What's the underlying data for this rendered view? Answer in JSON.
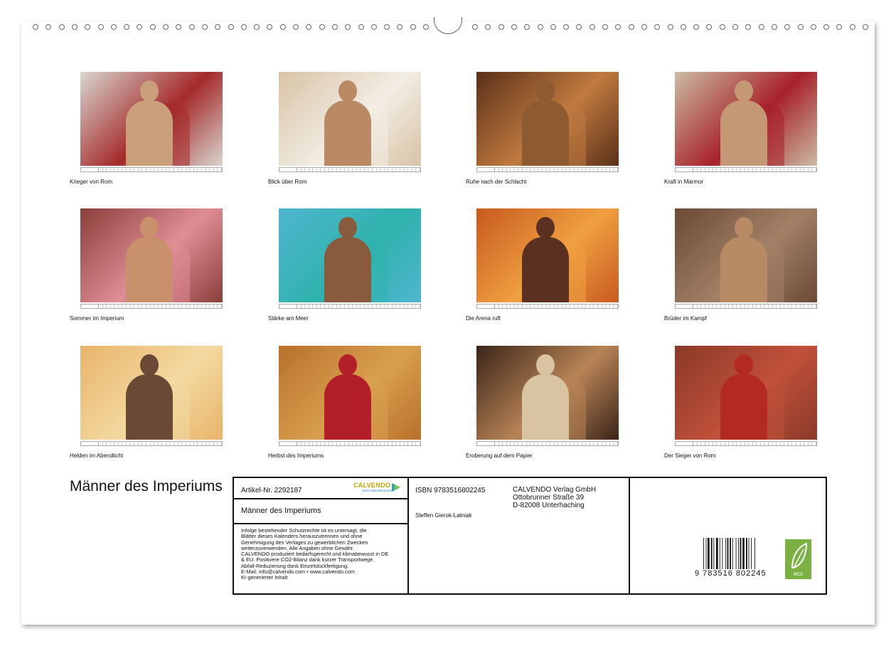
{
  "calendar": {
    "title": "Männer des Imperiums",
    "months": [
      {
        "caption": "Krieger von Rom",
        "palette": [
          "#d9d6d0",
          "#a52a2a",
          "#caa07a"
        ]
      },
      {
        "caption": "Blick über Rom",
        "palette": [
          "#d8c3a5",
          "#f2ede4",
          "#b98a64"
        ]
      },
      {
        "caption": "Ruhe nach der Schlacht",
        "palette": [
          "#5a3018",
          "#c07a40",
          "#8e5a32"
        ]
      },
      {
        "caption": "Kraft in Marmor",
        "palette": [
          "#cbbca3",
          "#a8222a",
          "#c49874"
        ]
      },
      {
        "caption": "Sommer im Imperium",
        "palette": [
          "#8a3f3a",
          "#e08d95",
          "#c9916b"
        ]
      },
      {
        "caption": "Stärke am Meer",
        "palette": [
          "#4fb6cf",
          "#2fb2ad",
          "#8a5a3c"
        ]
      },
      {
        "caption": "Die Arena ruft",
        "palette": [
          "#c75a20",
          "#f0a040",
          "#5a3020"
        ]
      },
      {
        "caption": "Brüder im Kampf",
        "palette": [
          "#6b4a36",
          "#a28066",
          "#b88a64"
        ]
      },
      {
        "caption": "Helden im Abendlicht",
        "palette": [
          "#e8b46a",
          "#f3d9a0",
          "#6a4a34"
        ]
      },
      {
        "caption": "Herbst des Imperiums",
        "palette": [
          "#b8702a",
          "#d9a050",
          "#b31f28"
        ]
      },
      {
        "caption": "Eroberung auf dem Papier",
        "palette": [
          "#3a2418",
          "#b88456",
          "#d8c4a0"
        ]
      },
      {
        "caption": "Der Sieger von Rom",
        "palette": [
          "#8a3a28",
          "#c0503a",
          "#b22a22"
        ]
      }
    ]
  },
  "info": {
    "article": "Artikel-Nr. 2292187",
    "logo": "CALVENDO",
    "logo_sub": "Dein Kalendermacher",
    "product_title": "Männer des Imperiums",
    "legal_lines": [
      "Infolge bestehender Schutzrechte ist es untersagt, die",
      "Blätter dieses Kalenders herauszutrennen und ohne",
      "Genehmigung des Verlages zu gewerblichen Zwecken",
      "weiterzuverwenden. Alle Angaben ohne Gewähr.",
      "CALVENDO produziert bedarfsgerecht und klimabewusst in DE",
      "& EU. Positivere CO2-Bilanz dank kurzer Transportwege.",
      "Abfall-Reduzierung dank Einzelstückfertigung.",
      "E-Mail: info@calvendo.com • www.calvendo.com",
      "KI-generierter Inhalt"
    ],
    "isbn": "ISBN 9783516802245",
    "author": "Steffen Gierok-Latniak",
    "publisher_lines": [
      "CALVENDO Verlag GmbH",
      "Ottobrunner Straße 39",
      "D-82008 Unterhaching"
    ],
    "barcode_number": "9 783516 802245",
    "eco_label": "eco"
  }
}
